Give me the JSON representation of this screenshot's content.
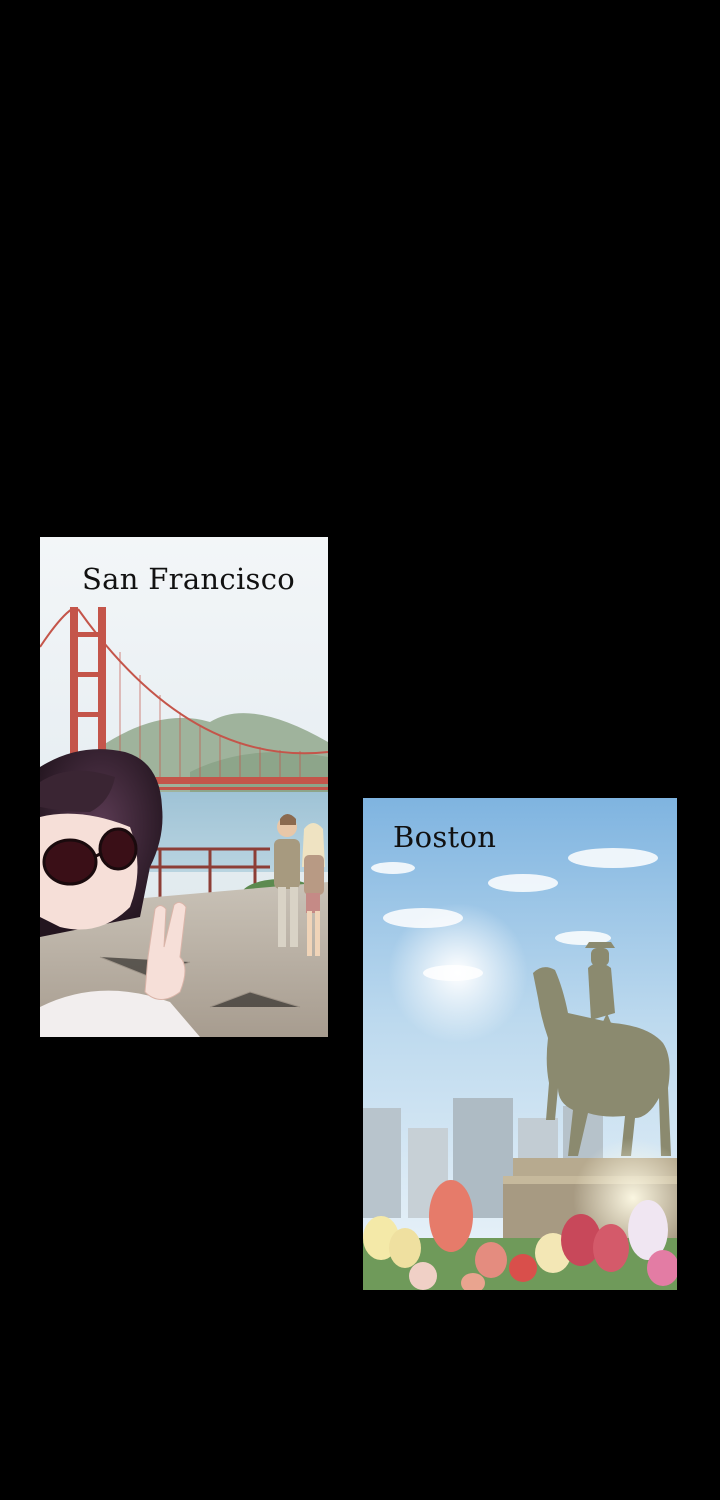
{
  "page": {
    "background": "#000000"
  },
  "panels": [
    {
      "caption": "San Francisco",
      "scene": "golden-gate-bridge-selfie"
    },
    {
      "caption": "Boston",
      "scene": "equestrian-statue-with-tulips"
    }
  ]
}
